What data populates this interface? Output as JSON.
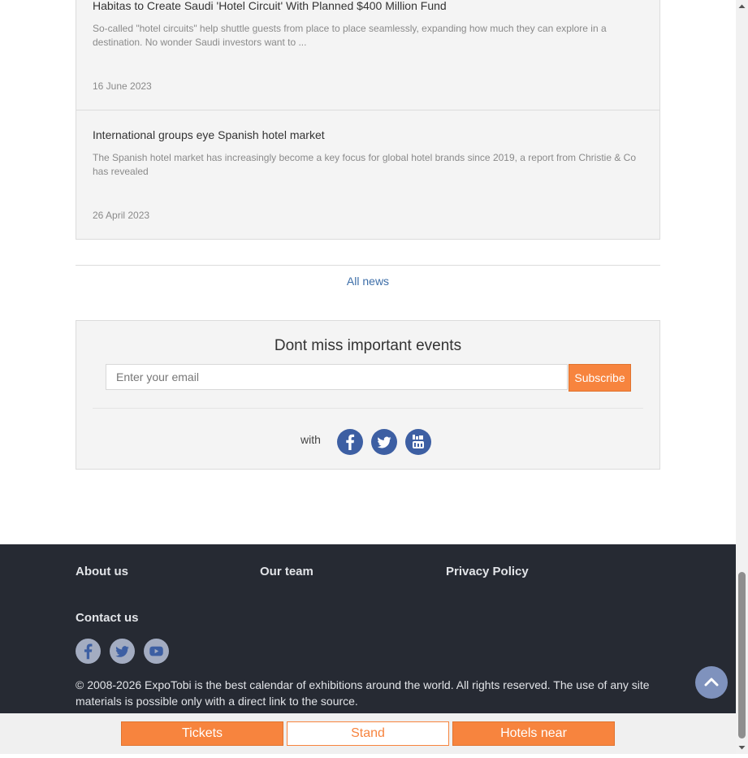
{
  "news": [
    {
      "title": "Habitas to Create Saudi 'Hotel Circuit' With Planned $400 Million Fund",
      "description": "So-called \"hotel circuits\" help shuttle guests from place to place seamlessly, expanding how much they can explore in a destination. No wonder Saudi investors want to ...",
      "date": "16 June 2023"
    },
    {
      "title": "International groups eye Spanish hotel market",
      "description": "The Spanish hotel market has increasingly become a key focus for global hotel brands since 2019, a report from Christie & Co has revealed",
      "date": "26 April 2023"
    }
  ],
  "all_news_label": "All news",
  "subscribe": {
    "title": "Dont miss important events",
    "email_placeholder": "Enter your email",
    "email_value": "",
    "button_label": "Subscribe",
    "with_label": "with",
    "social_icons": [
      "facebook-icon",
      "twitter-icon",
      "youtube-icon"
    ]
  },
  "footer": {
    "links": {
      "about": "About us",
      "team": "Our team",
      "privacy": "Privacy Policy",
      "contact": "Contact us"
    },
    "social_icons": [
      "facebook-icon",
      "twitter-icon",
      "youtube-icon"
    ],
    "copyright": "© 2008-2026 ExpoTobi is the best calendar of exhibitions around the world. All rights reserved. The use of any site materials is possible only with a direct link to the source."
  },
  "bottom_bar": {
    "tickets": "Tickets",
    "stand": "Stand",
    "hotels": "Hotels near"
  },
  "colors": {
    "accent_orange": "#f7843e",
    "link_blue": "#3d6ea8",
    "social_blue": "#3d5fa3",
    "footer_bg": "#262a33"
  },
  "icons": {
    "scroll_top": "chevron-up-icon"
  }
}
